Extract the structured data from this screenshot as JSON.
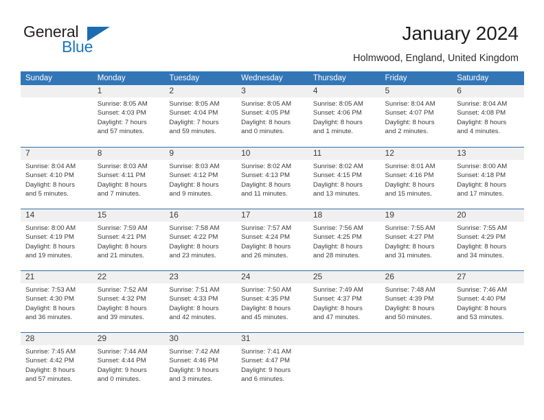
{
  "brand": {
    "name_dark": "General",
    "name_light": "Blue",
    "accent_color": "#1b75bc",
    "triangle_icon": "triangle-icon"
  },
  "header": {
    "title": "January 2024",
    "subtitle": "Holmwood, England, United Kingdom"
  },
  "calendar": {
    "header_bg": "#3276b8",
    "daynum_band_bg": "#f0f0f0",
    "weekday_headers": [
      "Sunday",
      "Monday",
      "Tuesday",
      "Wednesday",
      "Thursday",
      "Friday",
      "Saturday"
    ],
    "weeks": [
      [
        {
          "day": ""
        },
        {
          "day": "1",
          "sunrise": "Sunrise: 8:05 AM",
          "sunset": "Sunset: 4:03 PM",
          "daylight1": "Daylight: 7 hours",
          "daylight2": "and 57 minutes."
        },
        {
          "day": "2",
          "sunrise": "Sunrise: 8:05 AM",
          "sunset": "Sunset: 4:04 PM",
          "daylight1": "Daylight: 7 hours",
          "daylight2": "and 59 minutes."
        },
        {
          "day": "3",
          "sunrise": "Sunrise: 8:05 AM",
          "sunset": "Sunset: 4:05 PM",
          "daylight1": "Daylight: 8 hours",
          "daylight2": "and 0 minutes."
        },
        {
          "day": "4",
          "sunrise": "Sunrise: 8:05 AM",
          "sunset": "Sunset: 4:06 PM",
          "daylight1": "Daylight: 8 hours",
          "daylight2": "and 1 minute."
        },
        {
          "day": "5",
          "sunrise": "Sunrise: 8:04 AM",
          "sunset": "Sunset: 4:07 PM",
          "daylight1": "Daylight: 8 hours",
          "daylight2": "and 2 minutes."
        },
        {
          "day": "6",
          "sunrise": "Sunrise: 8:04 AM",
          "sunset": "Sunset: 4:08 PM",
          "daylight1": "Daylight: 8 hours",
          "daylight2": "and 4 minutes."
        }
      ],
      [
        {
          "day": "7",
          "sunrise": "Sunrise: 8:04 AM",
          "sunset": "Sunset: 4:10 PM",
          "daylight1": "Daylight: 8 hours",
          "daylight2": "and 5 minutes."
        },
        {
          "day": "8",
          "sunrise": "Sunrise: 8:03 AM",
          "sunset": "Sunset: 4:11 PM",
          "daylight1": "Daylight: 8 hours",
          "daylight2": "and 7 minutes."
        },
        {
          "day": "9",
          "sunrise": "Sunrise: 8:03 AM",
          "sunset": "Sunset: 4:12 PM",
          "daylight1": "Daylight: 8 hours",
          "daylight2": "and 9 minutes."
        },
        {
          "day": "10",
          "sunrise": "Sunrise: 8:02 AM",
          "sunset": "Sunset: 4:13 PM",
          "daylight1": "Daylight: 8 hours",
          "daylight2": "and 11 minutes."
        },
        {
          "day": "11",
          "sunrise": "Sunrise: 8:02 AM",
          "sunset": "Sunset: 4:15 PM",
          "daylight1": "Daylight: 8 hours",
          "daylight2": "and 13 minutes."
        },
        {
          "day": "12",
          "sunrise": "Sunrise: 8:01 AM",
          "sunset": "Sunset: 4:16 PM",
          "daylight1": "Daylight: 8 hours",
          "daylight2": "and 15 minutes."
        },
        {
          "day": "13",
          "sunrise": "Sunrise: 8:00 AM",
          "sunset": "Sunset: 4:18 PM",
          "daylight1": "Daylight: 8 hours",
          "daylight2": "and 17 minutes."
        }
      ],
      [
        {
          "day": "14",
          "sunrise": "Sunrise: 8:00 AM",
          "sunset": "Sunset: 4:19 PM",
          "daylight1": "Daylight: 8 hours",
          "daylight2": "and 19 minutes."
        },
        {
          "day": "15",
          "sunrise": "Sunrise: 7:59 AM",
          "sunset": "Sunset: 4:21 PM",
          "daylight1": "Daylight: 8 hours",
          "daylight2": "and 21 minutes."
        },
        {
          "day": "16",
          "sunrise": "Sunrise: 7:58 AM",
          "sunset": "Sunset: 4:22 PM",
          "daylight1": "Daylight: 8 hours",
          "daylight2": "and 23 minutes."
        },
        {
          "day": "17",
          "sunrise": "Sunrise: 7:57 AM",
          "sunset": "Sunset: 4:24 PM",
          "daylight1": "Daylight: 8 hours",
          "daylight2": "and 26 minutes."
        },
        {
          "day": "18",
          "sunrise": "Sunrise: 7:56 AM",
          "sunset": "Sunset: 4:25 PM",
          "daylight1": "Daylight: 8 hours",
          "daylight2": "and 28 minutes."
        },
        {
          "day": "19",
          "sunrise": "Sunrise: 7:55 AM",
          "sunset": "Sunset: 4:27 PM",
          "daylight1": "Daylight: 8 hours",
          "daylight2": "and 31 minutes."
        },
        {
          "day": "20",
          "sunrise": "Sunrise: 7:55 AM",
          "sunset": "Sunset: 4:29 PM",
          "daylight1": "Daylight: 8 hours",
          "daylight2": "and 34 minutes."
        }
      ],
      [
        {
          "day": "21",
          "sunrise": "Sunrise: 7:53 AM",
          "sunset": "Sunset: 4:30 PM",
          "daylight1": "Daylight: 8 hours",
          "daylight2": "and 36 minutes."
        },
        {
          "day": "22",
          "sunrise": "Sunrise: 7:52 AM",
          "sunset": "Sunset: 4:32 PM",
          "daylight1": "Daylight: 8 hours",
          "daylight2": "and 39 minutes."
        },
        {
          "day": "23",
          "sunrise": "Sunrise: 7:51 AM",
          "sunset": "Sunset: 4:33 PM",
          "daylight1": "Daylight: 8 hours",
          "daylight2": "and 42 minutes."
        },
        {
          "day": "24",
          "sunrise": "Sunrise: 7:50 AM",
          "sunset": "Sunset: 4:35 PM",
          "daylight1": "Daylight: 8 hours",
          "daylight2": "and 45 minutes."
        },
        {
          "day": "25",
          "sunrise": "Sunrise: 7:49 AM",
          "sunset": "Sunset: 4:37 PM",
          "daylight1": "Daylight: 8 hours",
          "daylight2": "and 47 minutes."
        },
        {
          "day": "26",
          "sunrise": "Sunrise: 7:48 AM",
          "sunset": "Sunset: 4:39 PM",
          "daylight1": "Daylight: 8 hours",
          "daylight2": "and 50 minutes."
        },
        {
          "day": "27",
          "sunrise": "Sunrise: 7:46 AM",
          "sunset": "Sunset: 4:40 PM",
          "daylight1": "Daylight: 8 hours",
          "daylight2": "and 53 minutes."
        }
      ],
      [
        {
          "day": "28",
          "sunrise": "Sunrise: 7:45 AM",
          "sunset": "Sunset: 4:42 PM",
          "daylight1": "Daylight: 8 hours",
          "daylight2": "and 57 minutes."
        },
        {
          "day": "29",
          "sunrise": "Sunrise: 7:44 AM",
          "sunset": "Sunset: 4:44 PM",
          "daylight1": "Daylight: 9 hours",
          "daylight2": "and 0 minutes."
        },
        {
          "day": "30",
          "sunrise": "Sunrise: 7:42 AM",
          "sunset": "Sunset: 4:46 PM",
          "daylight1": "Daylight: 9 hours",
          "daylight2": "and 3 minutes."
        },
        {
          "day": "31",
          "sunrise": "Sunrise: 7:41 AM",
          "sunset": "Sunset: 4:47 PM",
          "daylight1": "Daylight: 9 hours",
          "daylight2": "and 6 minutes."
        },
        {
          "day": ""
        },
        {
          "day": ""
        },
        {
          "day": ""
        }
      ]
    ]
  }
}
